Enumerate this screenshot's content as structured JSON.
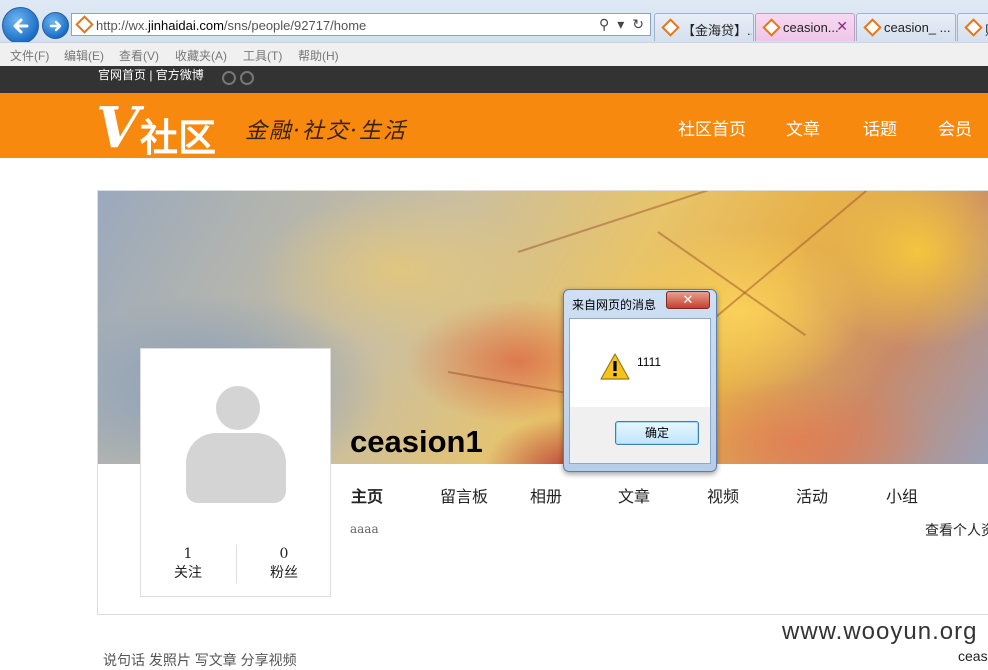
{
  "browser": {
    "url_prefix": "http://wx.",
    "url_domain": "jinhaidai.com",
    "url_path": "/sns/people/92717/home",
    "tabs": [
      {
        "title": "【金海贷】..."
      },
      {
        "title": "ceasion...",
        "active": true
      },
      {
        "title": "ceasion_ ..."
      },
      {
        "title": "账"
      }
    ],
    "menu": [
      "文件(F)",
      "编辑(E)",
      "查看(V)",
      "收藏夹(A)",
      "工具(T)",
      "帮助(H)"
    ]
  },
  "site": {
    "top_links": "官网首页 | 官方微博",
    "logo_v": "V",
    "logo_text": "社区",
    "slogan": "金融·社交·生活",
    "nav": [
      "社区首页",
      "文章",
      "话题",
      "会员"
    ],
    "accent_color": "#f7890e"
  },
  "profile": {
    "username": "ceasion1",
    "following_count": "1",
    "following_label": "关注",
    "followers_count": "0",
    "followers_label": "粉丝",
    "tabs": [
      "主页",
      "留言板",
      "相册",
      "文章",
      "视频",
      "活动",
      "小组"
    ],
    "bio": "aaaa",
    "view_info": "查看个人资"
  },
  "bottom": {
    "actions": "说句话 发照片 写文章 分享视频",
    "right_text": "ceas",
    "watermark": "www.wooyun.org"
  },
  "dialog": {
    "title": "来自网页的消息",
    "message": "1111",
    "ok_label": "确定",
    "icon": "warning-icon"
  }
}
